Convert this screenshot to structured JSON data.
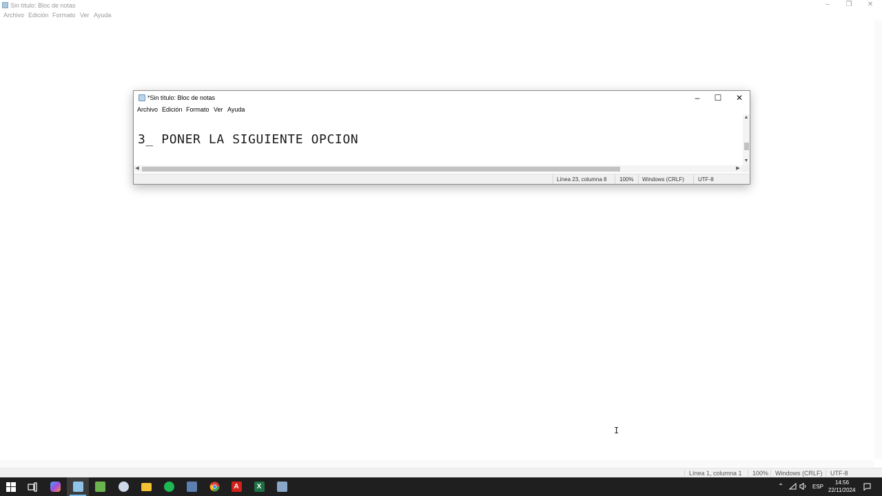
{
  "background_window": {
    "title": "Sin título: Bloc de notas",
    "menu": [
      "Archivo",
      "Edición",
      "Formato",
      "Ver",
      "Ayuda"
    ],
    "status": {
      "position": "Línea 1, columna 1",
      "zoom": "100%",
      "line_ending": "Windows (CRLF)",
      "encoding": "UTF-8"
    }
  },
  "notepad": {
    "title": "*Sin título: Bloc de notas",
    "menu": [
      "Archivo",
      "Edición",
      "Formato",
      "Ver",
      "Ayuda"
    ],
    "content": "3_ PONER LA SIGUIENTE OPCION",
    "status": {
      "position": "Línea 23, columna 8",
      "zoom": "100%",
      "line_ending": "Windows (CRLF)",
      "encoding": "UTF-8"
    }
  },
  "taskbar": {
    "apps": [
      {
        "name": "start",
        "color": "#ffffff"
      },
      {
        "name": "task-view",
        "color": "#ffffff"
      },
      {
        "name": "copilot",
        "color": "#6b7dff"
      },
      {
        "name": "notepad",
        "color": "#8fc3e8",
        "active": true
      },
      {
        "name": "notepad-plus",
        "color": "#6bb34f"
      },
      {
        "name": "snipping",
        "color": "#cfd8e6"
      },
      {
        "name": "file-explorer",
        "color": "#f2c232"
      },
      {
        "name": "spotify",
        "color": "#1db954"
      },
      {
        "name": "calculator",
        "color": "#5a7fb0"
      },
      {
        "name": "chrome",
        "color": "#e0402f"
      },
      {
        "name": "acrobat",
        "color": "#d4201b"
      },
      {
        "name": "excel",
        "color": "#1d7044"
      },
      {
        "name": "remote-desktop",
        "color": "#8aa6c8"
      }
    ],
    "language": "ESP",
    "time": "14:56",
    "date": "22/11/2024"
  }
}
